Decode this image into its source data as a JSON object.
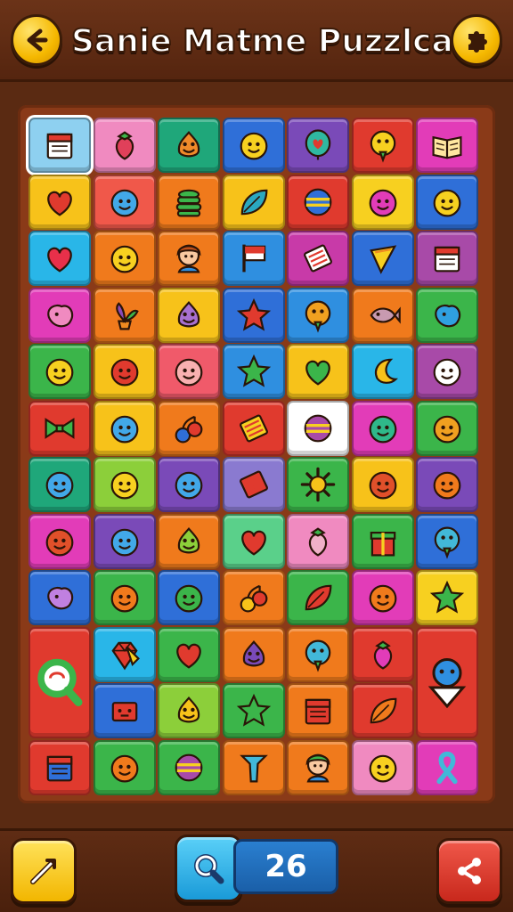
{
  "header": {
    "title": "Sanie Matme Puzzlca",
    "back_icon": "back-arrow-icon",
    "settings_icon": "puzzle-settings-icon"
  },
  "footer": {
    "hint_icon": "wand-hint-icon",
    "search_icon": "magnifier-icon",
    "moves_count": "26",
    "share_icon": "share-icon"
  },
  "colors": {
    "yellow": "#f7c21a",
    "pink": "#f08ac0",
    "green": "#3bb54a",
    "blue": "#2f6fd8",
    "purple": "#7a4ab8",
    "red": "#e03a2e",
    "magenta": "#e23cb8",
    "orange": "#f07a1c",
    "cyan": "#29b6e8",
    "lime": "#8ccf3a",
    "teal": "#18a89a"
  },
  "board": {
    "tiles": [
      {
        "bg": "#8ed0f0",
        "icon": "calendar",
        "fg": "#ffffff",
        "selected": true
      },
      {
        "bg": "#f08ac0",
        "icon": "strawberry",
        "fg": "#e0405a"
      },
      {
        "bg": "#1fa77a",
        "icon": "pear-face",
        "fg": "#f08a2a"
      },
      {
        "bg": "#2f6fd8",
        "icon": "smiley",
        "fg": "#f7d020"
      },
      {
        "bg": "#7a4ab8",
        "icon": "balloon-heart",
        "fg": "#2fb8a0"
      },
      {
        "bg": "#e03a2e",
        "icon": "bird-face",
        "fg": "#f7d020"
      },
      {
        "bg": "#e23cb8",
        "icon": "book",
        "fg": "#ffe7a0"
      },
      {
        "bg": "#f7c21a",
        "icon": "heart",
        "fg": "#e03a2e"
      },
      {
        "bg": "#f0584a",
        "icon": "smiley",
        "fg": "#42a8e8"
      },
      {
        "bg": "#f07a1c",
        "icon": "stack",
        "fg": "#3bb54a"
      },
      {
        "bg": "#f7c21a",
        "icon": "leaf",
        "fg": "#2aa8c0"
      },
      {
        "bg": "#e03a2e",
        "icon": "ball",
        "fg": "#2f6fd8"
      },
      {
        "bg": "#f7d020",
        "icon": "smiley",
        "fg": "#e23cb8"
      },
      {
        "bg": "#2f6fd8",
        "icon": "smiley",
        "fg": "#f7d020"
      },
      {
        "bg": "#29b6e8",
        "icon": "heart",
        "fg": "#e8304a"
      },
      {
        "bg": "#f07a1c",
        "icon": "smiley",
        "fg": "#f7d020"
      },
      {
        "bg": "#f07a1c",
        "icon": "person",
        "fg": "#c0501a"
      },
      {
        "bg": "#2f8fe0",
        "icon": "flag",
        "fg": "#e03a2e"
      },
      {
        "bg": "#c83aa8",
        "icon": "card",
        "fg": "#ffffff"
      },
      {
        "bg": "#2f6fd8",
        "icon": "cone",
        "fg": "#f7d020"
      },
      {
        "bg": "#a84aa8",
        "icon": "calendar",
        "fg": "#ffffff"
      },
      {
        "bg": "#e23cb8",
        "icon": "blob",
        "fg": "#f08ac0"
      },
      {
        "bg": "#f07a1c",
        "icon": "plant",
        "fg": "#8a4ab8"
      },
      {
        "bg": "#f7c21a",
        "icon": "pear-face",
        "fg": "#a870d0"
      },
      {
        "bg": "#2f6fd8",
        "icon": "star",
        "fg": "#e03a2e"
      },
      {
        "bg": "#2f8fe0",
        "icon": "bird-face",
        "fg": "#f0a020"
      },
      {
        "bg": "#f07a1c",
        "icon": "fish",
        "fg": "#c89ab0"
      },
      {
        "bg": "#3bb54a",
        "icon": "blob",
        "fg": "#2fa0e0"
      },
      {
        "bg": "#3bb54a",
        "icon": "smiley",
        "fg": "#f7d020"
      },
      {
        "bg": "#f7c21a",
        "icon": "smiley",
        "fg": "#e03a2e"
      },
      {
        "bg": "#f05a6a",
        "icon": "smiley",
        "fg": "#f8b0b0"
      },
      {
        "bg": "#2f8fe0",
        "icon": "star",
        "fg": "#3bb54a"
      },
      {
        "bg": "#f7c21a",
        "icon": "heart",
        "fg": "#3bb54a"
      },
      {
        "bg": "#29b6e8",
        "icon": "moon",
        "fg": "#f7c21a"
      },
      {
        "bg": "#a84aa8",
        "icon": "smiley",
        "fg": "#ffffff"
      },
      {
        "bg": "#e03a2e",
        "icon": "bow",
        "fg": "#3bb54a"
      },
      {
        "bg": "#f7c21a",
        "icon": "smiley",
        "fg": "#42a8e8"
      },
      {
        "bg": "#f07a1c",
        "icon": "cherry",
        "fg": "#2f6fd8"
      },
      {
        "bg": "#e03a2e",
        "icon": "card",
        "fg": "#f7d020"
      },
      {
        "bg": "#ffffff",
        "icon": "ball",
        "fg": "#a84aa8"
      },
      {
        "bg": "#e23cb8",
        "icon": "smiley",
        "fg": "#2fb88a"
      },
      {
        "bg": "#3bb54a",
        "icon": "smiley",
        "fg": "#f0a020"
      },
      {
        "bg": "#1fa77a",
        "icon": "smiley",
        "fg": "#42a8e8"
      },
      {
        "bg": "#8ccf3a",
        "icon": "smiley",
        "fg": "#f7d020"
      },
      {
        "bg": "#7a4ab8",
        "icon": "smiley",
        "fg": "#42a8e8"
      },
      {
        "bg": "#8a7ad0",
        "icon": "card",
        "fg": "#e03a2e"
      },
      {
        "bg": "#3bb54a",
        "icon": "sun",
        "fg": "#f7c21a"
      },
      {
        "bg": "#f7c21a",
        "icon": "smiley",
        "fg": "#e0502a"
      },
      {
        "bg": "#7a4ab8",
        "icon": "smiley",
        "fg": "#f07a1c"
      },
      {
        "bg": "#e23cb8",
        "icon": "smiley",
        "fg": "#e0502a"
      },
      {
        "bg": "#7a4ab8",
        "icon": "smiley",
        "fg": "#42a8e8"
      },
      {
        "bg": "#f07a1c",
        "icon": "pear-face",
        "fg": "#8ccf3a"
      },
      {
        "bg": "#5ad08a",
        "icon": "heart",
        "fg": "#e03a2e"
      },
      {
        "bg": "#f08ac0",
        "icon": "strawberry",
        "fg": "#f0b0c8"
      },
      {
        "bg": "#3bb54a",
        "icon": "gift",
        "fg": "#e03a2e"
      },
      {
        "bg": "#2f6fd8",
        "icon": "bird-face",
        "fg": "#42b8d8"
      },
      {
        "bg": "#2f6fd8",
        "icon": "blob",
        "fg": "#c080e0"
      },
      {
        "bg": "#3bb54a",
        "icon": "smiley",
        "fg": "#f07a1c"
      },
      {
        "bg": "#2f6fd8",
        "icon": "smiley",
        "fg": "#3bb54a"
      },
      {
        "bg": "#f07a1c",
        "icon": "cherry",
        "fg": "#f7c21a"
      },
      {
        "bg": "#3bb54a",
        "icon": "leaf",
        "fg": "#e03a2e"
      },
      {
        "bg": "#e23cb8",
        "icon": "smiley",
        "fg": "#f07a1c"
      },
      {
        "bg": "#f7d020",
        "icon": "star",
        "fg": "#3bb54a"
      },
      {
        "bg": "#29b6e8",
        "icon": "gem",
        "fg": "#e03a2e"
      },
      {
        "bg": "#3bb54a",
        "icon": "heart",
        "fg": "#e03a2e"
      },
      {
        "bg": "#f07a1c",
        "icon": "pear-face",
        "fg": "#7a4ab8"
      },
      {
        "bg": "#f07a1c",
        "icon": "bird-face",
        "fg": "#42b8d8"
      },
      {
        "bg": "#e03a2e",
        "icon": "strawberry",
        "fg": "#e23cb8"
      },
      {
        "bg": "#2f6fd8",
        "icon": "box",
        "fg": "#e03a2e"
      },
      {
        "bg": "#8ccf3a",
        "icon": "pear-face",
        "fg": "#f7c21a"
      },
      {
        "bg": "#3bb54a",
        "icon": "star",
        "fg": "#3bb54a"
      },
      {
        "bg": "#f07a1c",
        "icon": "calendar",
        "fg": "#e03a2e"
      },
      {
        "bg": "#e03a2e",
        "icon": "leaf",
        "fg": "#f07a1c"
      },
      {
        "bg": "#e03a2e",
        "icon": "calendar",
        "fg": "#2f6fd8"
      },
      {
        "bg": "#3bb54a",
        "icon": "smiley",
        "fg": "#f07a1c"
      },
      {
        "bg": "#3bb54a",
        "icon": "ball",
        "fg": "#a84aa8"
      },
      {
        "bg": "#f07a1c",
        "icon": "arrow-up",
        "fg": "#42b8d8"
      },
      {
        "bg": "#f07a1c",
        "icon": "person",
        "fg": "#3bb54a"
      },
      {
        "bg": "#f08ac0",
        "icon": "smiley",
        "fg": "#f7d020"
      },
      {
        "bg": "#e23cb8",
        "icon": "ribbon",
        "fg": "#42b8d8"
      },
      {
        "bg": "#e03a2e",
        "icon": "magnifier",
        "fg": "#3bb54a",
        "tall": "left"
      },
      {
        "bg": "#e03a2e",
        "icon": "smiley-arrow",
        "fg": "#2f8fe0",
        "tall": "right"
      }
    ]
  }
}
